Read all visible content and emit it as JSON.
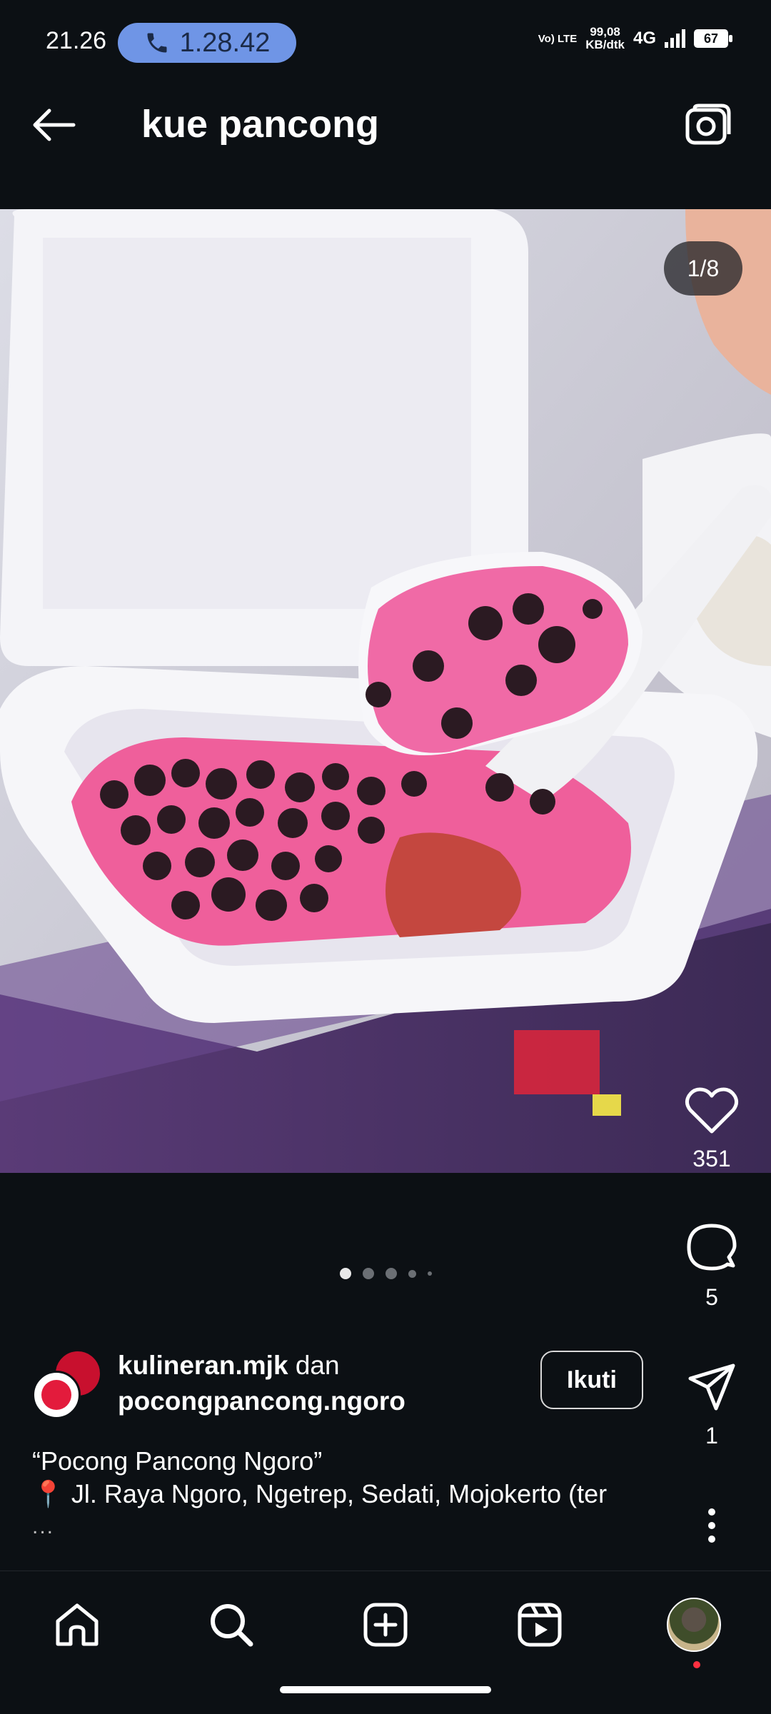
{
  "status_bar": {
    "time": "21.26",
    "call_duration": "1.28.42",
    "network_type_top": "Vo) LTE",
    "data_rate_value": "99,08",
    "data_rate_unit": "KB/dtk",
    "network_gen": "4G",
    "battery": "67"
  },
  "header": {
    "title": "kue pancong"
  },
  "post": {
    "image_counter": "1/8",
    "image_description": "Kue pancong with pink topping and chocolate chips in a white styrofoam box",
    "carousel_dots": 5,
    "active_dot_index": 0
  },
  "side_actions": {
    "likes": "351",
    "comments": "5",
    "shares": "1"
  },
  "author": {
    "name1": "kulineran.mjk",
    "joiner": "dan",
    "name2": "pocongpancong.ngoro",
    "follow_label": "Ikuti"
  },
  "caption": {
    "line1": "“Pocong Pancong Ngoro”",
    "line2": "📍 Jl. Raya Ngoro, Ngetrep, Sedati, Mojokerto (ter",
    "more": "..."
  },
  "colors": {
    "background": "#0c1014",
    "call_pill": "#6f95e6",
    "notification_dot": "#ff3040"
  }
}
